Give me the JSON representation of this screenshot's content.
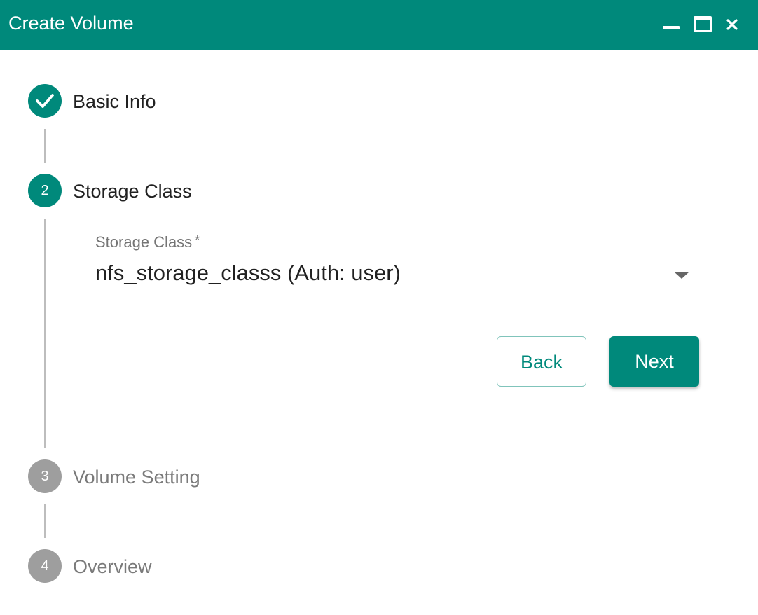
{
  "window": {
    "title": "Create Volume",
    "controls": [
      "minimize-icon",
      "maximize-icon",
      "close-icon"
    ]
  },
  "steps": [
    {
      "number": "1",
      "label": "Basic Info",
      "state": "completed",
      "icon": "check-icon"
    },
    {
      "number": "2",
      "label": "Storage Class",
      "state": "active"
    },
    {
      "number": "3",
      "label": "Volume Setting",
      "state": "inactive"
    },
    {
      "number": "4",
      "label": "Overview",
      "state": "inactive"
    }
  ],
  "storage_class_field": {
    "label": "Storage Class",
    "required_marker": "*",
    "value": "nfs_storage_classs (Auth: user)"
  },
  "buttons": {
    "back": "Back",
    "next": "Next"
  },
  "colors": {
    "accent": "#00897b",
    "inactive_step": "#9e9e9e"
  }
}
